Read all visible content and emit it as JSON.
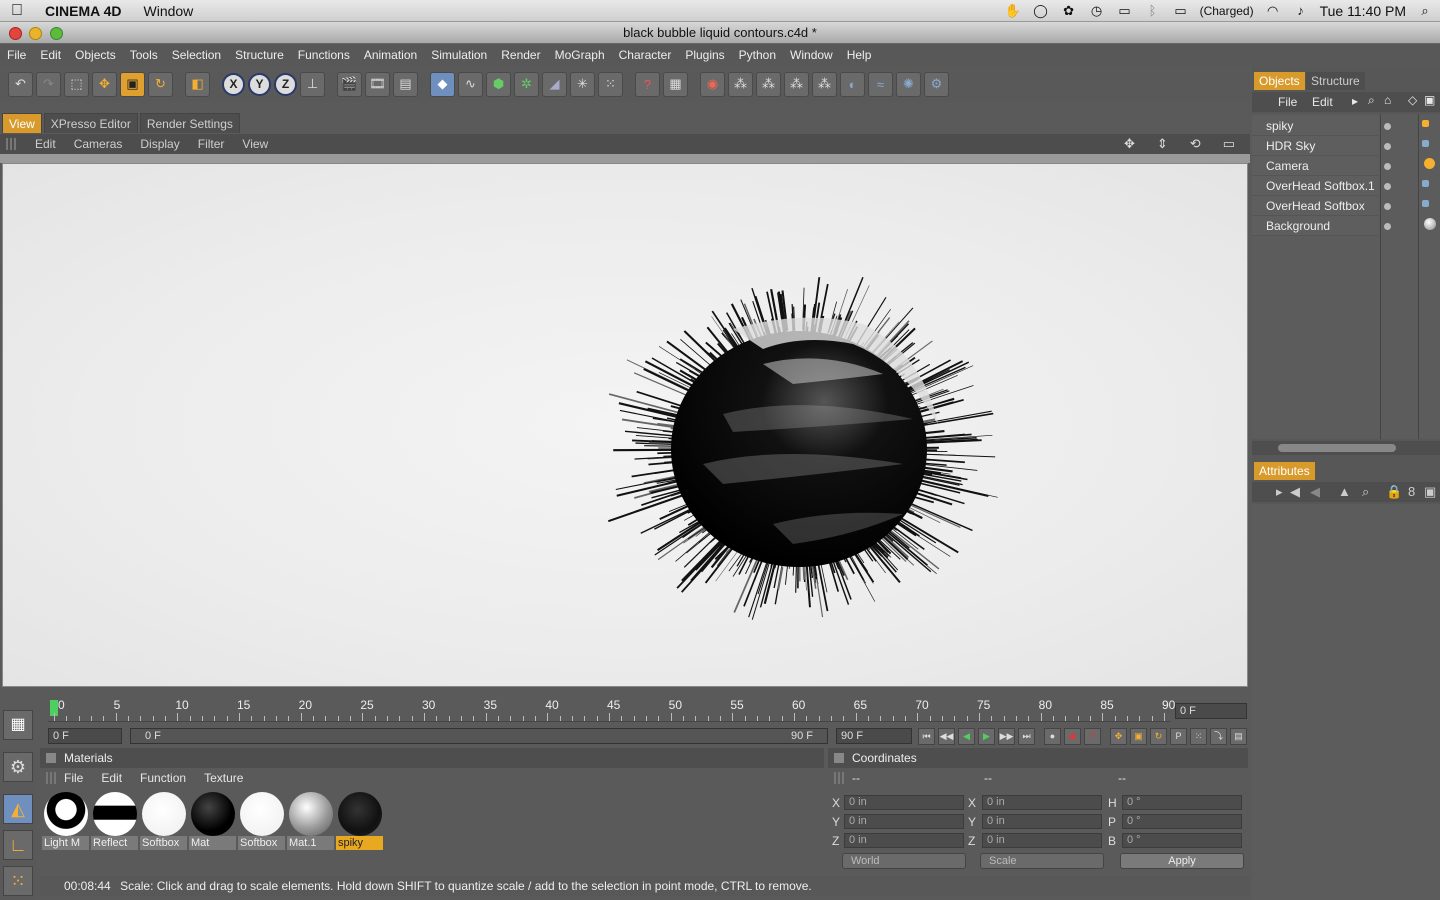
{
  "mac_menubar": {
    "apple": "",
    "app_name": "CINEMA 4D",
    "menu": "Window",
    "battery": "(Charged)",
    "clock": "Tue 11:40 PM"
  },
  "window": {
    "title": "black bubble liquid contours.c4d *"
  },
  "app_menu": [
    "File",
    "Edit",
    "Objects",
    "Tools",
    "Selection",
    "Structure",
    "Functions",
    "Animation",
    "Simulation",
    "Render",
    "MoGraph",
    "Character",
    "Plugins",
    "Python",
    "Window",
    "Help"
  ],
  "toolbar_axes": [
    "X",
    "Y",
    "Z"
  ],
  "view_tabs": [
    "View",
    "XPresso Editor",
    "Render Settings"
  ],
  "view_menu": [
    "Edit",
    "Cameras",
    "Display",
    "Filter",
    "View"
  ],
  "timeline": {
    "labels": [
      "0",
      "5",
      "10",
      "15",
      "20",
      "25",
      "30",
      "35",
      "40",
      "45",
      "50",
      "55",
      "60",
      "65",
      "70",
      "75",
      "80",
      "85",
      "90"
    ],
    "current_frame": "0 F",
    "start_field": "0 F",
    "range_start": "0 F",
    "range_end": "90 F",
    "end_field": "90 F"
  },
  "materials": {
    "title": "Materials",
    "menu": [
      "File",
      "Edit",
      "Function",
      "Texture"
    ],
    "items": [
      {
        "label": "Light M"
      },
      {
        "label": "Reflect"
      },
      {
        "label": "Softbox"
      },
      {
        "label": "Mat"
      },
      {
        "label": "Softbox"
      },
      {
        "label": "Mat.1"
      },
      {
        "label": "spiky"
      }
    ]
  },
  "coordinates": {
    "title": "Coordinates",
    "headers": [
      "--",
      "--",
      "--"
    ],
    "rows": [
      {
        "a": "X",
        "av": "0 in",
        "b": "X",
        "bv": "0 in",
        "c": "H",
        "cv": "0 °"
      },
      {
        "a": "Y",
        "av": "0 in",
        "b": "Y",
        "bv": "0 in",
        "c": "P",
        "cv": "0 °"
      },
      {
        "a": "Z",
        "av": "0 in",
        "b": "Z",
        "bv": "0 in",
        "c": "B",
        "cv": "0 °"
      }
    ],
    "space": "World",
    "mode": "Scale",
    "apply": "Apply"
  },
  "status": {
    "time": "00:08:44",
    "message": "Scale: Click and drag to scale elements. Hold down SHIFT to quantize scale / add to the selection in point mode, CTRL to remove."
  },
  "objects": {
    "tabs": [
      "Objects",
      "Structure"
    ],
    "menu": [
      "File",
      "Edit"
    ],
    "items": [
      "spiky",
      "HDR Sky",
      "Camera",
      "OverHead Softbox.1",
      "OverHead Softbox",
      "Background"
    ]
  },
  "attributes": {
    "tab": "Attributes"
  }
}
